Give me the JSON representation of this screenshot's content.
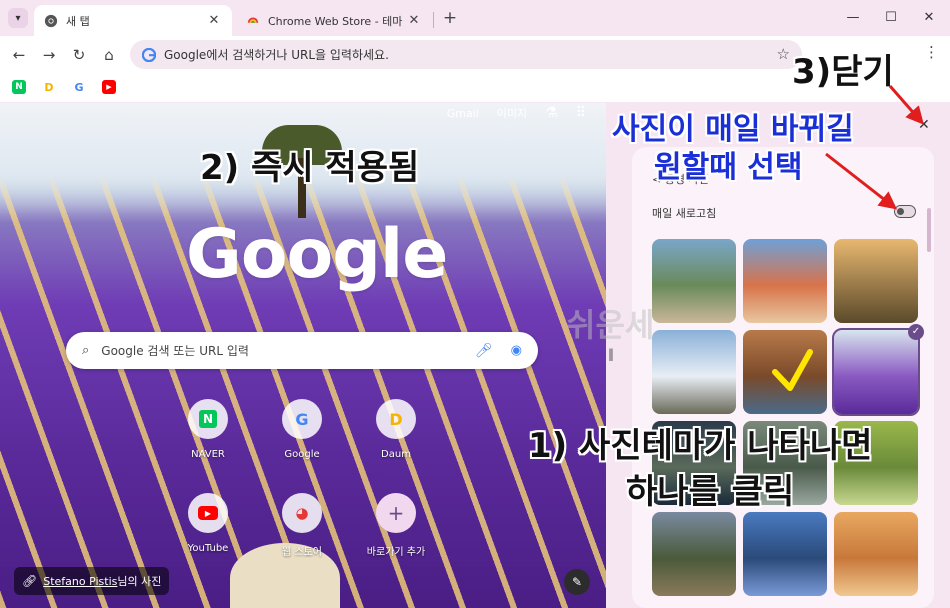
{
  "tabs": [
    {
      "title": "새 탭",
      "active": true
    },
    {
      "title": "Chrome Web Store - 테마",
      "active": false
    }
  ],
  "omnibox": {
    "placeholder": "Google에서 검색하거나 URL을 입력하세요."
  },
  "bookmarks": [
    {
      "name": "naver-bookmark",
      "glyph": "N",
      "color": "#03c75a"
    },
    {
      "name": "daum-bookmark",
      "glyph": "D",
      "color": "#f4b400"
    },
    {
      "name": "google-bookmark",
      "glyph": "G",
      "color": "#4285f4"
    },
    {
      "name": "youtube-bookmark",
      "glyph": "▶",
      "color": "#ff0000"
    }
  ],
  "ntp": {
    "top_links": {
      "gmail": "Gmail",
      "images": "이미지"
    },
    "logo": "Google",
    "search_placeholder": "Google 검색 또는 URL 입력",
    "shortcuts": [
      {
        "label": "NAVER",
        "glyph": "N",
        "color": "#03c75a"
      },
      {
        "label": "Google",
        "glyph": "G",
        "color": "#4285f4"
      },
      {
        "label": "Daum",
        "glyph": "D",
        "color": "#f4b400"
      },
      {
        "label": "YouTube",
        "glyph": "▶",
        "color": "#ff0000"
      },
      {
        "label": "웹 스토어",
        "glyph": "◕",
        "color": "#e53935"
      },
      {
        "label": "바로가기 추가",
        "glyph": "+",
        "color": "#6b4c8a"
      }
    ],
    "credit": {
      "author": "Stefano Pistis",
      "suffix": "님의 사진"
    }
  },
  "panel": {
    "back_title": "< 풍경 사진",
    "toggle_label": "매일 새로고침",
    "toggle_on": false,
    "thumbnails": [
      {
        "name": "thumb-rocky-lake",
        "colors": [
          "#7aa6c9",
          "#6a8a5a",
          "#c9b79a"
        ]
      },
      {
        "name": "thumb-red-arch",
        "colors": [
          "#6fa0d8",
          "#d8734a",
          "#e8c7a0"
        ]
      },
      {
        "name": "thumb-canyon-sunset",
        "colors": [
          "#e8b870",
          "#9a7a4a",
          "#5a4a2a"
        ]
      },
      {
        "name": "thumb-snowy-mountains",
        "colors": [
          "#8ab0d8",
          "#e8eef4",
          "#6a6a5a"
        ]
      },
      {
        "name": "thumb-river-canyon",
        "colors": [
          "#b87a4a",
          "#7a4a2a",
          "#4a6a8a"
        ]
      },
      {
        "name": "thumb-lavender-field",
        "colors": [
          "#d8e4ee",
          "#8a5ac2",
          "#5a2a9a"
        ]
      },
      {
        "name": "thumb-dark-coast",
        "colors": [
          "#2a3a4a",
          "#5a6a5a",
          "#1a2a3a"
        ]
      },
      {
        "name": "thumb-misty-forest",
        "colors": [
          "#7a8a7a",
          "#4a5a4a",
          "#9aa8a0"
        ]
      },
      {
        "name": "thumb-green-hills",
        "colors": [
          "#9ab84a",
          "#6a8a3a",
          "#c8d890"
        ]
      },
      {
        "name": "thumb-old-bridge",
        "colors": [
          "#7a8aa0",
          "#4a5a3a",
          "#8a7a5a"
        ]
      },
      {
        "name": "thumb-blue-lake",
        "colors": [
          "#4a7ac0",
          "#2a4a7a",
          "#7a9ad8"
        ]
      },
      {
        "name": "thumb-desert-dunes",
        "colors": [
          "#e8a860",
          "#c8783a",
          "#f0c890"
        ]
      }
    ],
    "selected_index": 5
  },
  "annotations": {
    "step1_line1": "1) 사진테마가 나타나면",
    "step1_line2": "하나를 클릭",
    "step2": "2) 즉시 적용됨",
    "step3": "3)닫기",
    "daily_line1": "사진이 매일 바뀌길",
    "daily_line2": "원할때 선택",
    "watermark": "쉬운세"
  },
  "colors": {
    "annotation_blue": "#1a2fd6",
    "arrow_red": "#e01e1e",
    "check_yellow": "#ffe600"
  }
}
